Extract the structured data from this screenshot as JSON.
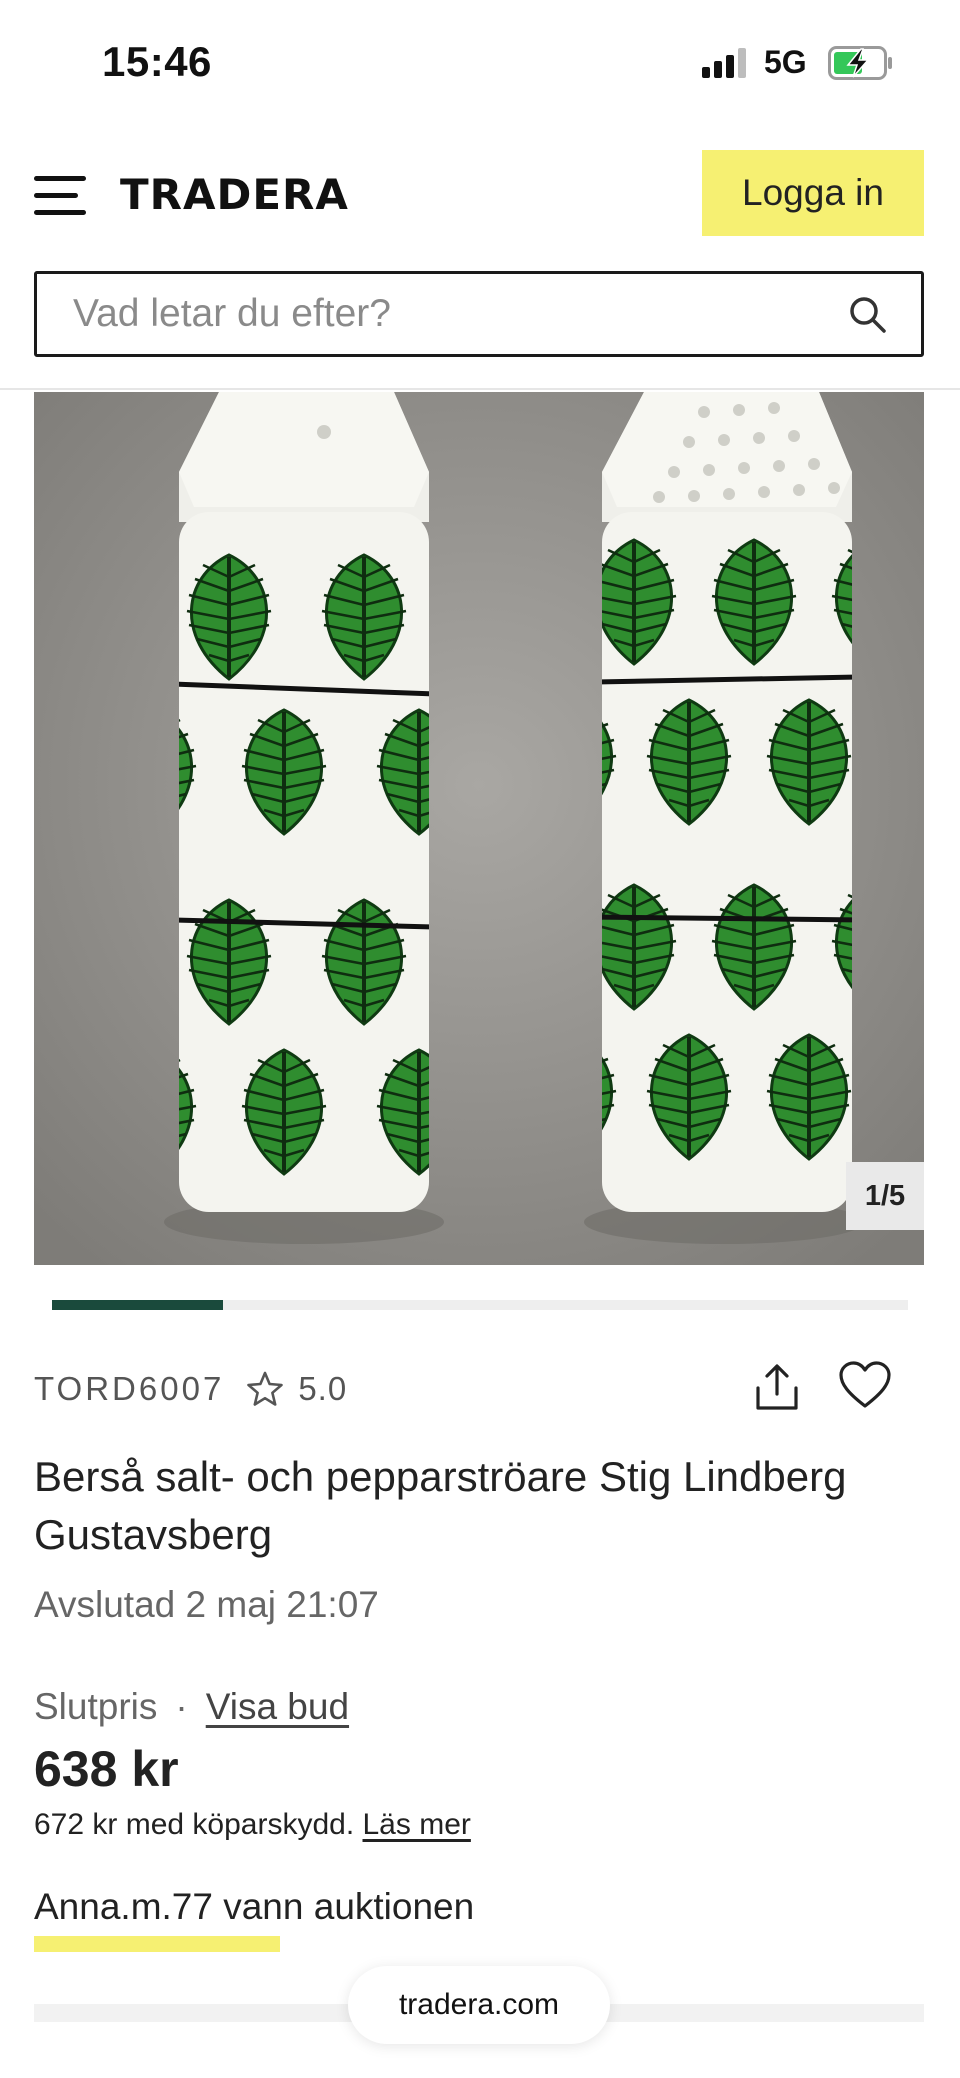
{
  "status_bar": {
    "time": "15:46",
    "network": "5G"
  },
  "header": {
    "logo": "TRADERA",
    "login_label": "Logga in",
    "search": {
      "placeholder": "Vad letar du efter?"
    }
  },
  "gallery": {
    "counter": "1/5",
    "progress_fraction": 0.2
  },
  "seller": {
    "name": "TORD6007",
    "rating": "5.0"
  },
  "item": {
    "title": "Berså salt- och pepparströare Stig Lindberg Gustavsberg",
    "ended": "Avslutad 2 maj 21:07",
    "price_label": "Slutpris",
    "price_separator": "·",
    "bids_link": "Visa bud",
    "price": "638 kr",
    "protection_text": "672 kr med köparskydd.",
    "protection_link": "Läs mer",
    "winner_text": "Anna.m.77 vann auktionen"
  },
  "browser": {
    "url": "tradera.com"
  },
  "colors": {
    "accent_yellow": "#f6f072",
    "progress_green": "#1a4a3c",
    "leaf_green": "#2e8b2e"
  }
}
